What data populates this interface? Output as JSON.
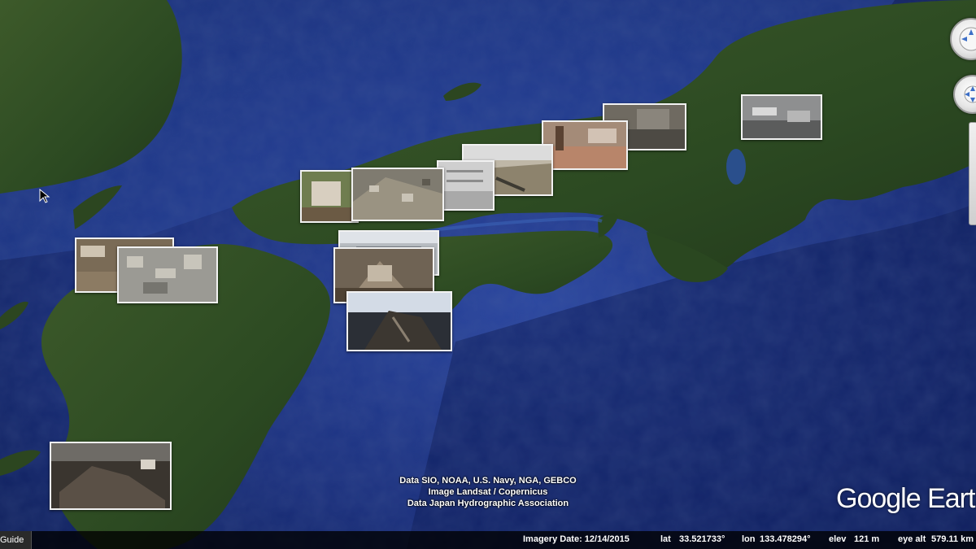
{
  "attribution": {
    "line1": "Data SIO, NOAA, U.S. Navy, NGA, GEBCO",
    "line2": "Image Landsat / Copernicus",
    "line3": "Data Japan Hydrographic Association"
  },
  "logo_text": "Google Earth",
  "status_bar": {
    "guide_label": "Guide",
    "imagery_date": "Imagery Date: 12/14/2015",
    "lat_label": "lat",
    "lat_value": "33.521733°",
    "lon_label": "lon",
    "lon_value": "133.478294°",
    "elev_label": "elev",
    "elev_value": "121 m",
    "eye_alt_label": "eye alt",
    "eye_alt_value": "579.11 km"
  },
  "photo_markers": [
    {
      "name": "photo-marker-kinki-flood"
    },
    {
      "name": "photo-marker-street-flood"
    },
    {
      "name": "photo-marker-muddy-room"
    },
    {
      "name": "photo-marker-river-bank"
    },
    {
      "name": "photo-marker-okayama-house"
    },
    {
      "name": "photo-marker-aerial-town"
    },
    {
      "name": "photo-marker-building-wall"
    },
    {
      "name": "photo-marker-hiroshima-damage"
    },
    {
      "name": "photo-marker-landslide-debris"
    },
    {
      "name": "photo-marker-kyushu-house"
    },
    {
      "name": "photo-marker-aerial-flood"
    },
    {
      "name": "photo-marker-kagoshima-debris"
    }
  ],
  "colors": {
    "ocean_deep": "#0a1a4f",
    "ocean_shelf": "#2d4fa6",
    "land_forest": "#2f4d22",
    "photo_border": "#f2f2f2"
  },
  "icons": [
    "navigation-compass-icon",
    "look-around-icon",
    "zoom-slider-icon",
    "mouse-cursor-icon"
  ]
}
